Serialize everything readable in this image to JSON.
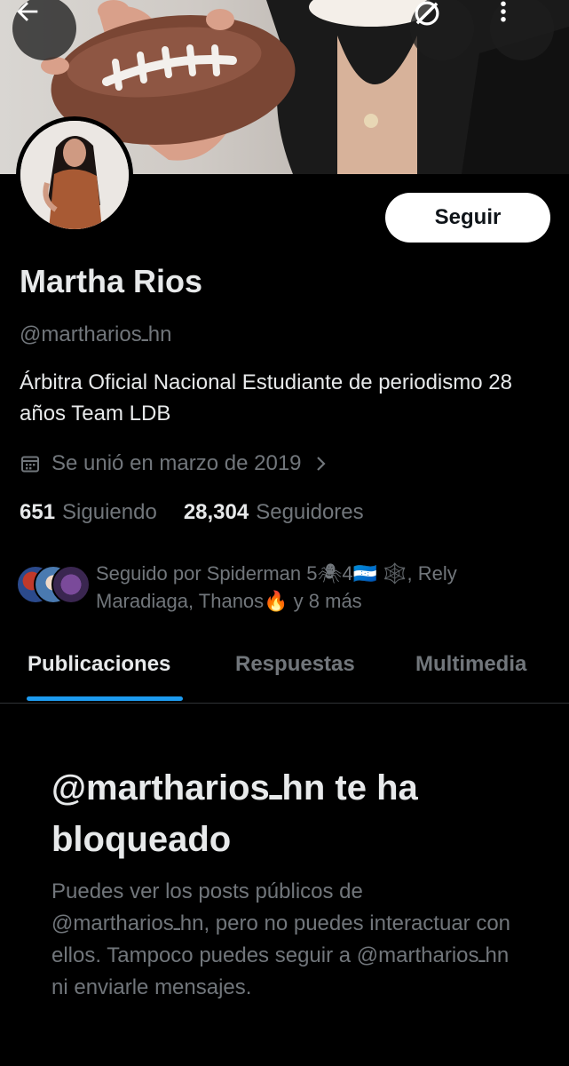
{
  "header": {
    "back_icon": "arrow-left-icon",
    "grok_icon": "grok-icon",
    "more_icon": "more-vertical-icon"
  },
  "profile": {
    "follow_label": "Seguir",
    "name": "Martha Rios",
    "handle": "@marthariosـhn",
    "bio": "Árbitra Oficial Nacional Estudiante de periodismo 28 años Team LDB",
    "joined": "Se unió en marzo de 2019",
    "following_count": "651",
    "following_label": "Siguiendo",
    "followers_count": "28,304",
    "followers_label": "Seguidores",
    "followed_by": "Seguido por Spiderman 5🕷4🇭🇳 🕸️, Rely Maradiaga, Thanos🔥 y 8 más"
  },
  "tabs": [
    {
      "label": "Publicaciones",
      "active": true
    },
    {
      "label": "Respuestas",
      "active": false
    },
    {
      "label": "Multimedia",
      "active": false
    }
  ],
  "blocked": {
    "title": "@marthariosـhn te ha bloqueado",
    "body": "Puedes ver los posts públicos de @marthariosـhn, pero no puedes interactuar con ellos. Tampoco puedes seguir a @marthariosـhn ni enviarle mensajes."
  },
  "colors": {
    "background": "#000000",
    "text_primary": "#e7e9ea",
    "text_secondary": "#71767b",
    "accent": "#1d9bf0",
    "follow_button_bg": "#ffffff"
  }
}
